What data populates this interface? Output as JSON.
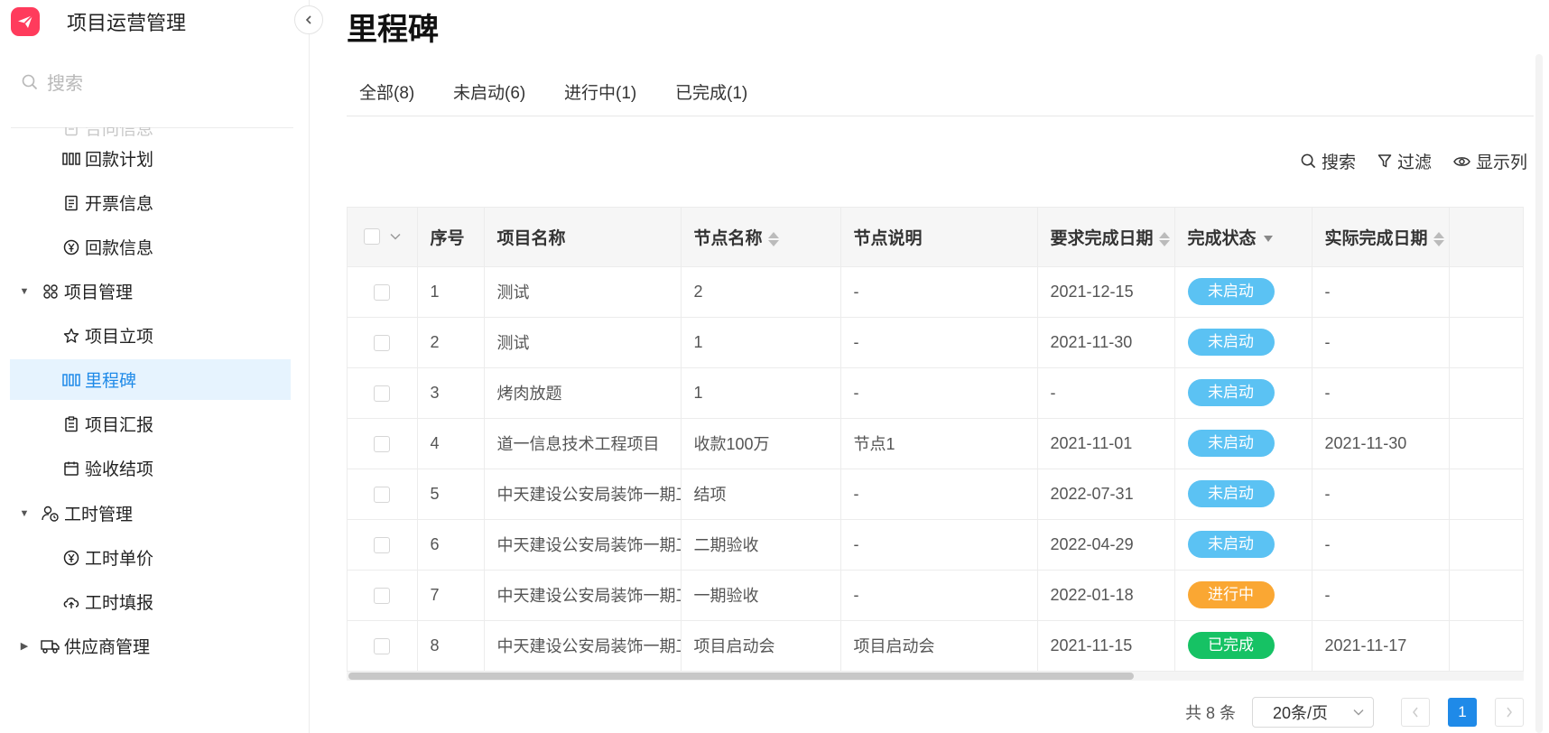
{
  "app": {
    "title": "项目运营管理"
  },
  "search": {
    "label": "搜索"
  },
  "sidebar": {
    "items": [
      {
        "label": "合同信息",
        "icon": "document-icon",
        "type": "child",
        "state": "faded"
      },
      {
        "label": "回款计划",
        "icon": "milestone-icon",
        "type": "child"
      },
      {
        "label": "开票信息",
        "icon": "invoice-icon",
        "type": "child"
      },
      {
        "label": "回款信息",
        "icon": "yen-icon",
        "type": "child"
      },
      {
        "label": "项目管理",
        "icon": "nodes-icon",
        "type": "group",
        "expanded": true
      },
      {
        "label": "项目立项",
        "icon": "star-icon",
        "type": "child"
      },
      {
        "label": "里程碑",
        "icon": "milestone-icon",
        "type": "child",
        "active": true
      },
      {
        "label": "项目汇报",
        "icon": "report-icon",
        "type": "child"
      },
      {
        "label": "验收结项",
        "icon": "calendar-icon",
        "type": "child"
      },
      {
        "label": "工时管理",
        "icon": "person-clock-icon",
        "type": "group",
        "expanded": true
      },
      {
        "label": "工时单价",
        "icon": "yen-icon",
        "type": "child"
      },
      {
        "label": "工时填报",
        "icon": "cloud-upload-icon",
        "type": "child"
      },
      {
        "label": "供应商管理",
        "icon": "truck-icon",
        "type": "group",
        "expanded": false
      }
    ]
  },
  "page": {
    "title": "里程碑"
  },
  "tabs": [
    {
      "label": "全部(8)",
      "active": true
    },
    {
      "label": "未启动(6)"
    },
    {
      "label": "进行中(1)"
    },
    {
      "label": "已完成(1)"
    }
  ],
  "toolbar": {
    "search": "搜索",
    "filter": "过滤",
    "columns": "显示列"
  },
  "table": {
    "columns": [
      "序号",
      "项目名称",
      "节点名称",
      "节点说明",
      "要求完成日期",
      "完成状态",
      "实际完成日期"
    ],
    "rows": [
      {
        "no": "1",
        "project": "测试",
        "node": "2",
        "desc": "-",
        "due": "2021-12-15",
        "status": "未启动",
        "actual": "-"
      },
      {
        "no": "2",
        "project": "测试",
        "node": "1",
        "desc": "-",
        "due": "2021-11-30",
        "status": "未启动",
        "actual": "-"
      },
      {
        "no": "3",
        "project": "烤肉放题",
        "node": "1",
        "desc": "-",
        "due": "-",
        "status": "未启动",
        "actual": "-"
      },
      {
        "no": "4",
        "project": "道一信息技术工程项目",
        "node": "收款100万",
        "desc": "节点1",
        "due": "2021-11-01",
        "status": "未启动",
        "actual": "2021-11-30"
      },
      {
        "no": "5",
        "project": "中天建设公安局装饰一期工",
        "node": "结项",
        "desc": "-",
        "due": "2022-07-31",
        "status": "未启动",
        "actual": "-"
      },
      {
        "no": "6",
        "project": "中天建设公安局装饰一期工",
        "node": "二期验收",
        "desc": "-",
        "due": "2022-04-29",
        "status": "未启动",
        "actual": "-"
      },
      {
        "no": "7",
        "project": "中天建设公安局装饰一期工",
        "node": "一期验收",
        "desc": "-",
        "due": "2022-01-18",
        "status": "进行中",
        "actual": "-"
      },
      {
        "no": "8",
        "project": "中天建设公安局装饰一期工",
        "node": "项目启动会",
        "desc": "项目启动会",
        "due": "2021-11-15",
        "status": "已完成",
        "actual": "2021-11-17"
      }
    ]
  },
  "status_colors": {
    "未启动": "#5bc2f3",
    "进行中": "#faa733",
    "已完成": "#16c264"
  },
  "pagination": {
    "total": "共 8 条",
    "page_size": "20条/页",
    "current": "1"
  },
  "colors": {
    "accent": "#1f8ae8",
    "brand": "#ff3b5c",
    "active_bg": "#e6f3fe"
  }
}
